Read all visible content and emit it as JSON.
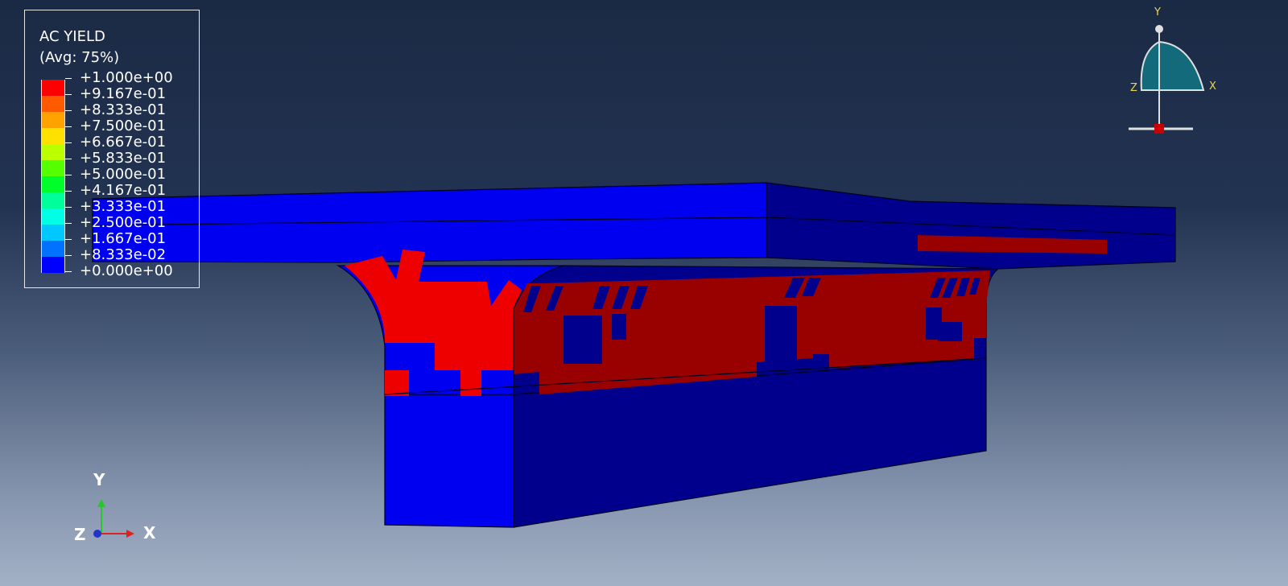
{
  "legend": {
    "title": "AC YIELD",
    "subtitle": "(Avg: 75%)",
    "entries": [
      {
        "label": "+1.000e+00",
        "color": "#ff0000"
      },
      {
        "label": "+9.167e-01",
        "color": "#ff5a00"
      },
      {
        "label": "+8.333e-01",
        "color": "#ffa200"
      },
      {
        "label": "+7.500e-01",
        "color": "#ffe100"
      },
      {
        "label": "+6.667e-01",
        "color": "#bbff00"
      },
      {
        "label": "+5.833e-01",
        "color": "#55ff00"
      },
      {
        "label": "+5.000e-01",
        "color": "#00ff2a"
      },
      {
        "label": "+4.167e-01",
        "color": "#00ff9a"
      },
      {
        "label": "+3.333e-01",
        "color": "#00ffe4"
      },
      {
        "label": "+2.500e-01",
        "color": "#00c8ff"
      },
      {
        "label": "+1.667e-01",
        "color": "#0072ff"
      },
      {
        "label": "+8.333e-02",
        "color": "#0000ff"
      },
      {
        "label": "+0.000e+00",
        "color": ""
      }
    ]
  },
  "triad": {
    "x": "X",
    "y": "Y",
    "z": "Z"
  },
  "view_cube": {
    "x": "X",
    "y": "Y",
    "z": "Z"
  },
  "colors": {
    "yield_high": "#ee0000",
    "yield_high_dark": "#990000",
    "yield_zero": "#0000ff",
    "yield_zero_dark": "#000088"
  }
}
